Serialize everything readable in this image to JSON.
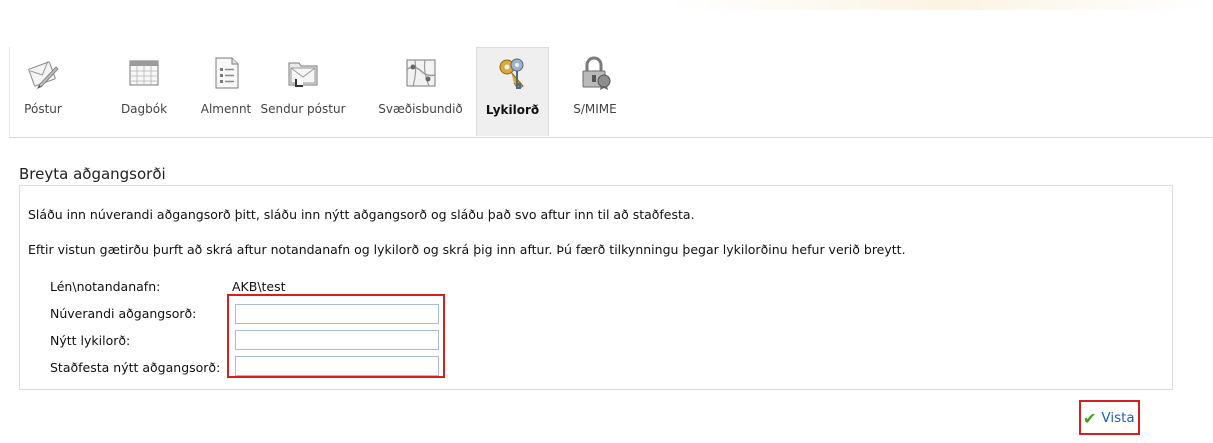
{
  "toolbar": {
    "tabs": [
      {
        "label": "Póstur",
        "icon": "mail-icon"
      },
      {
        "label": "Dagbók",
        "icon": "calendar-icon"
      },
      {
        "label": "Almennt",
        "icon": "list-icon"
      },
      {
        "label": "Sendur póstur",
        "icon": "sent-mail-icon"
      },
      {
        "label": "Svæðisbundið",
        "icon": "regional-map-icon"
      },
      {
        "label": "Lykilorð",
        "icon": "keys-icon",
        "active": true
      },
      {
        "label": "S/MIME",
        "icon": "lock-certificate-icon"
      }
    ]
  },
  "section": {
    "title": "Breyta aðgangsorði",
    "instruction1": "Sláðu inn núverandi aðgangsorð þitt, sláðu inn nýtt aðgangsorð og sláðu það svo aftur inn til að staðfesta.",
    "instruction2": "Eftir vistun gætirðu þurft að skrá aftur notandanafn og lykilorð og skrá þig inn aftur. Þú færð tilkynningu þegar lykilorðinu hefur verið breytt."
  },
  "form": {
    "domain_label": "Lén\\notandanafn:",
    "domain_value": "AKB\\test",
    "current_label": "Núverandi aðgangsorð:",
    "current_value": "",
    "new_label": "Nýtt lykilorð:",
    "new_value": "",
    "confirm_label": "Staðfesta nýtt aðgangsorð:",
    "confirm_value": ""
  },
  "actions": {
    "save_label": "Vista"
  },
  "colors": {
    "highlight": "#d42020",
    "accent_link": "#1f5fbf",
    "check": "#3aa318"
  }
}
